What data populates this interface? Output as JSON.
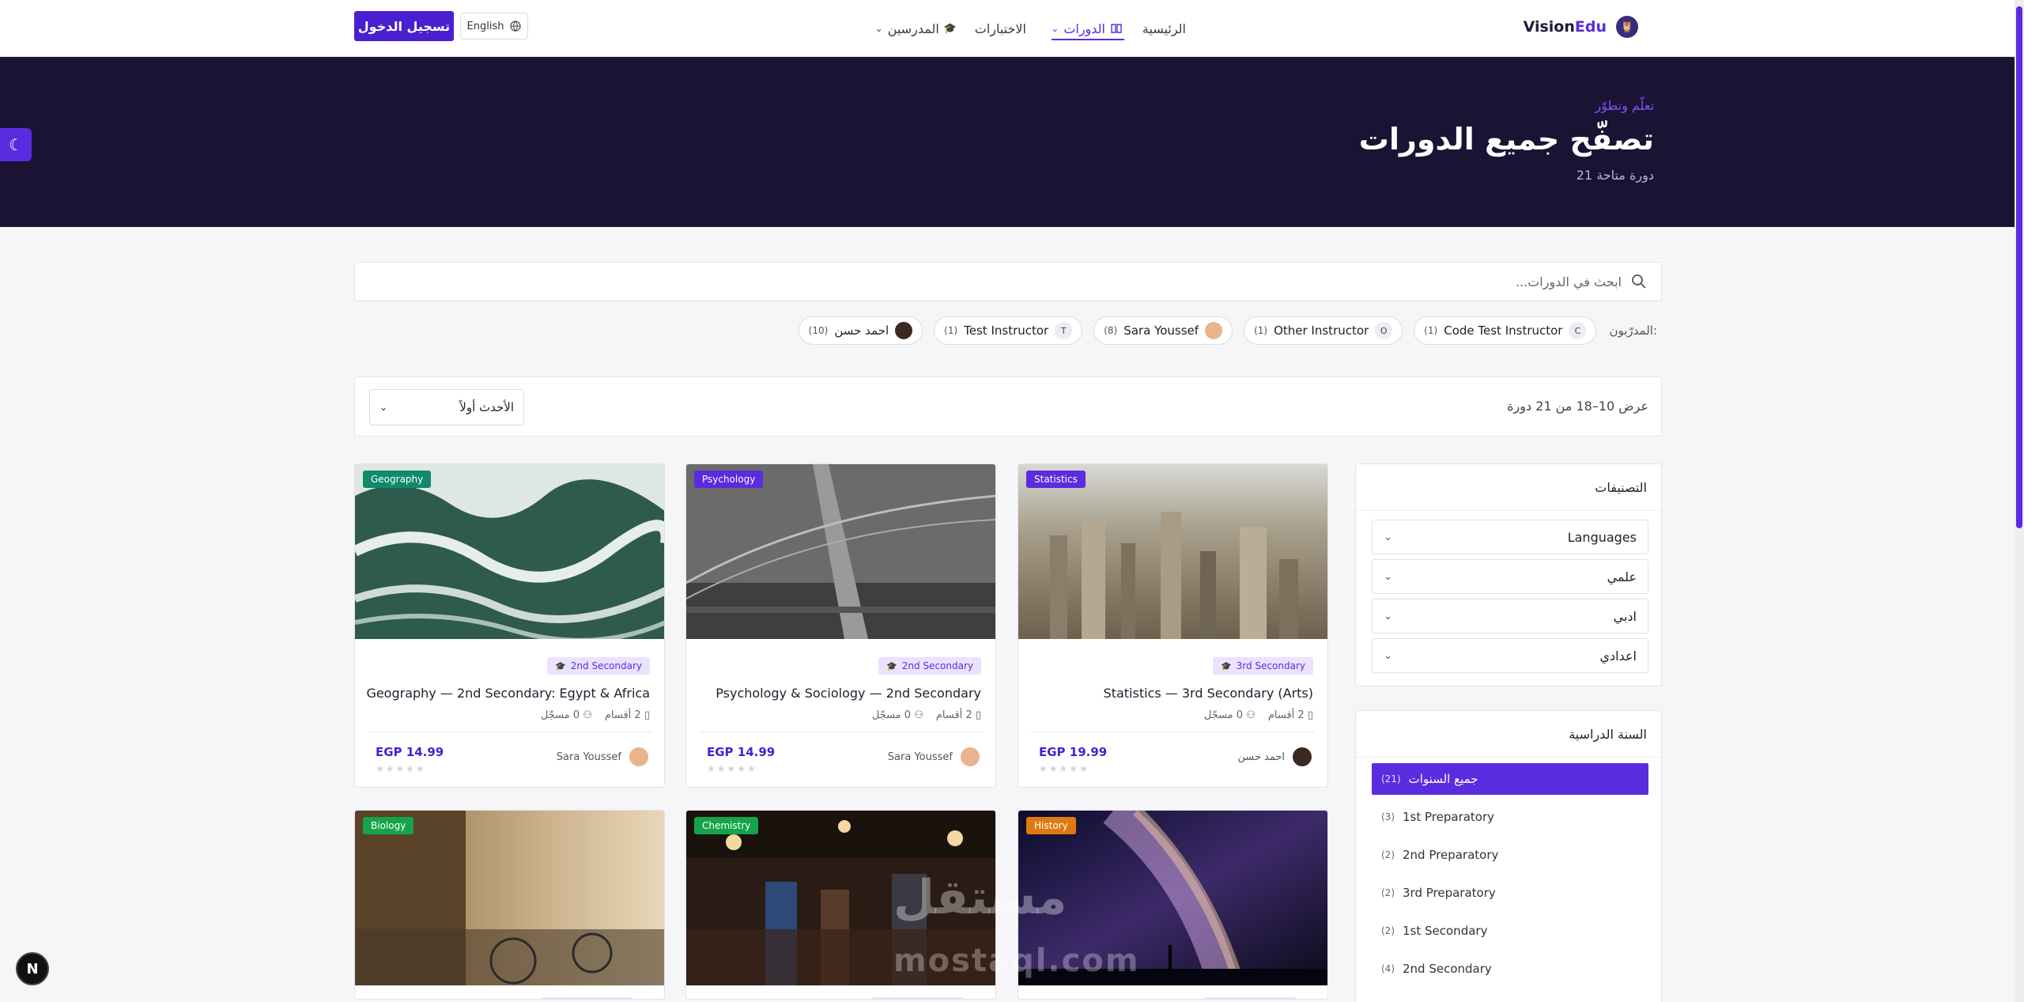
{
  "header": {
    "logo_prefix": "Vision",
    "logo_suffix": "Edu",
    "nav": {
      "home": "الرئيسية",
      "courses": "الدورات",
      "exams": "الاختبارات",
      "teachers": "المدرسين"
    },
    "language": "English",
    "login": "تسجيل الدخول"
  },
  "hero": {
    "kicker": "تعلّم وتطوّر",
    "title": "تصفّح جميع الدورات",
    "count": "21 دورة متاحة"
  },
  "search": {
    "placeholder": "ابحث في الدورات..."
  },
  "instructors": {
    "label": "المدرّبون:",
    "items": [
      {
        "name": "Code Test Instructor",
        "count": "(1)",
        "initial": "C"
      },
      {
        "name": "Other Instructor",
        "count": "(1)",
        "initial": "O"
      },
      {
        "name": "Sara Youssef",
        "count": "(8)",
        "initial": ""
      },
      {
        "name": "Test Instructor",
        "count": "(1)",
        "initial": "T"
      },
      {
        "name": "احمد حسن",
        "count": "(10)",
        "initial": ""
      }
    ]
  },
  "results": {
    "summary": "عرض 10–18 من 21 دورة",
    "sort": "الأحدث أولاً"
  },
  "sidebar": {
    "categories_title": "التصنيفات",
    "categories": [
      "Languages",
      "علمي",
      "ادبي",
      "اعدادي"
    ],
    "years_title": "السنة الدراسية",
    "years": [
      {
        "label": "جميع السنوات",
        "count": "(21)"
      },
      {
        "label": "1st Preparatory",
        "count": "(3)"
      },
      {
        "label": "2nd Preparatory",
        "count": "(2)"
      },
      {
        "label": "3rd Preparatory",
        "count": "(2)"
      },
      {
        "label": "1st Secondary",
        "count": "(2)"
      },
      {
        "label": "2nd Secondary",
        "count": "(4)"
      }
    ]
  },
  "courses": [
    {
      "category": "Statistics",
      "category_color": "#5b2be0",
      "level": "3rd Secondary",
      "title": "Statistics — 3rd Secondary (Arts)",
      "sections": "2 أقسام",
      "students": "0 مسجّل",
      "price": "EGP 19.99",
      "instructor": "احمد حسن"
    },
    {
      "category": "Psychology",
      "category_color": "#5b2be0",
      "level": "2nd Secondary",
      "title": "Psychology & Sociology — 2nd Secondary",
      "sections": "2 أقسام",
      "students": "0 مسجّل",
      "price": "EGP 14.99",
      "instructor": "Sara Youssef"
    },
    {
      "category": "Geography",
      "category_color": "#0f8a6a",
      "level": "2nd Secondary",
      "title": "Geography — 2nd Secondary: Egypt & Africa",
      "sections": "2 أقسام",
      "students": "0 مسجّل",
      "price": "EGP 14.99",
      "instructor": "Sara Youssef"
    },
    {
      "category": "History",
      "category_color": "#e07a10"
    },
    {
      "category": "Chemistry",
      "category_color": "#16a34a"
    },
    {
      "category": "Biology",
      "category_color": "#16a34a"
    }
  ],
  "watermark": {
    "ar": "مستقل",
    "en": "mostaql.com"
  },
  "next_badge": "N"
}
